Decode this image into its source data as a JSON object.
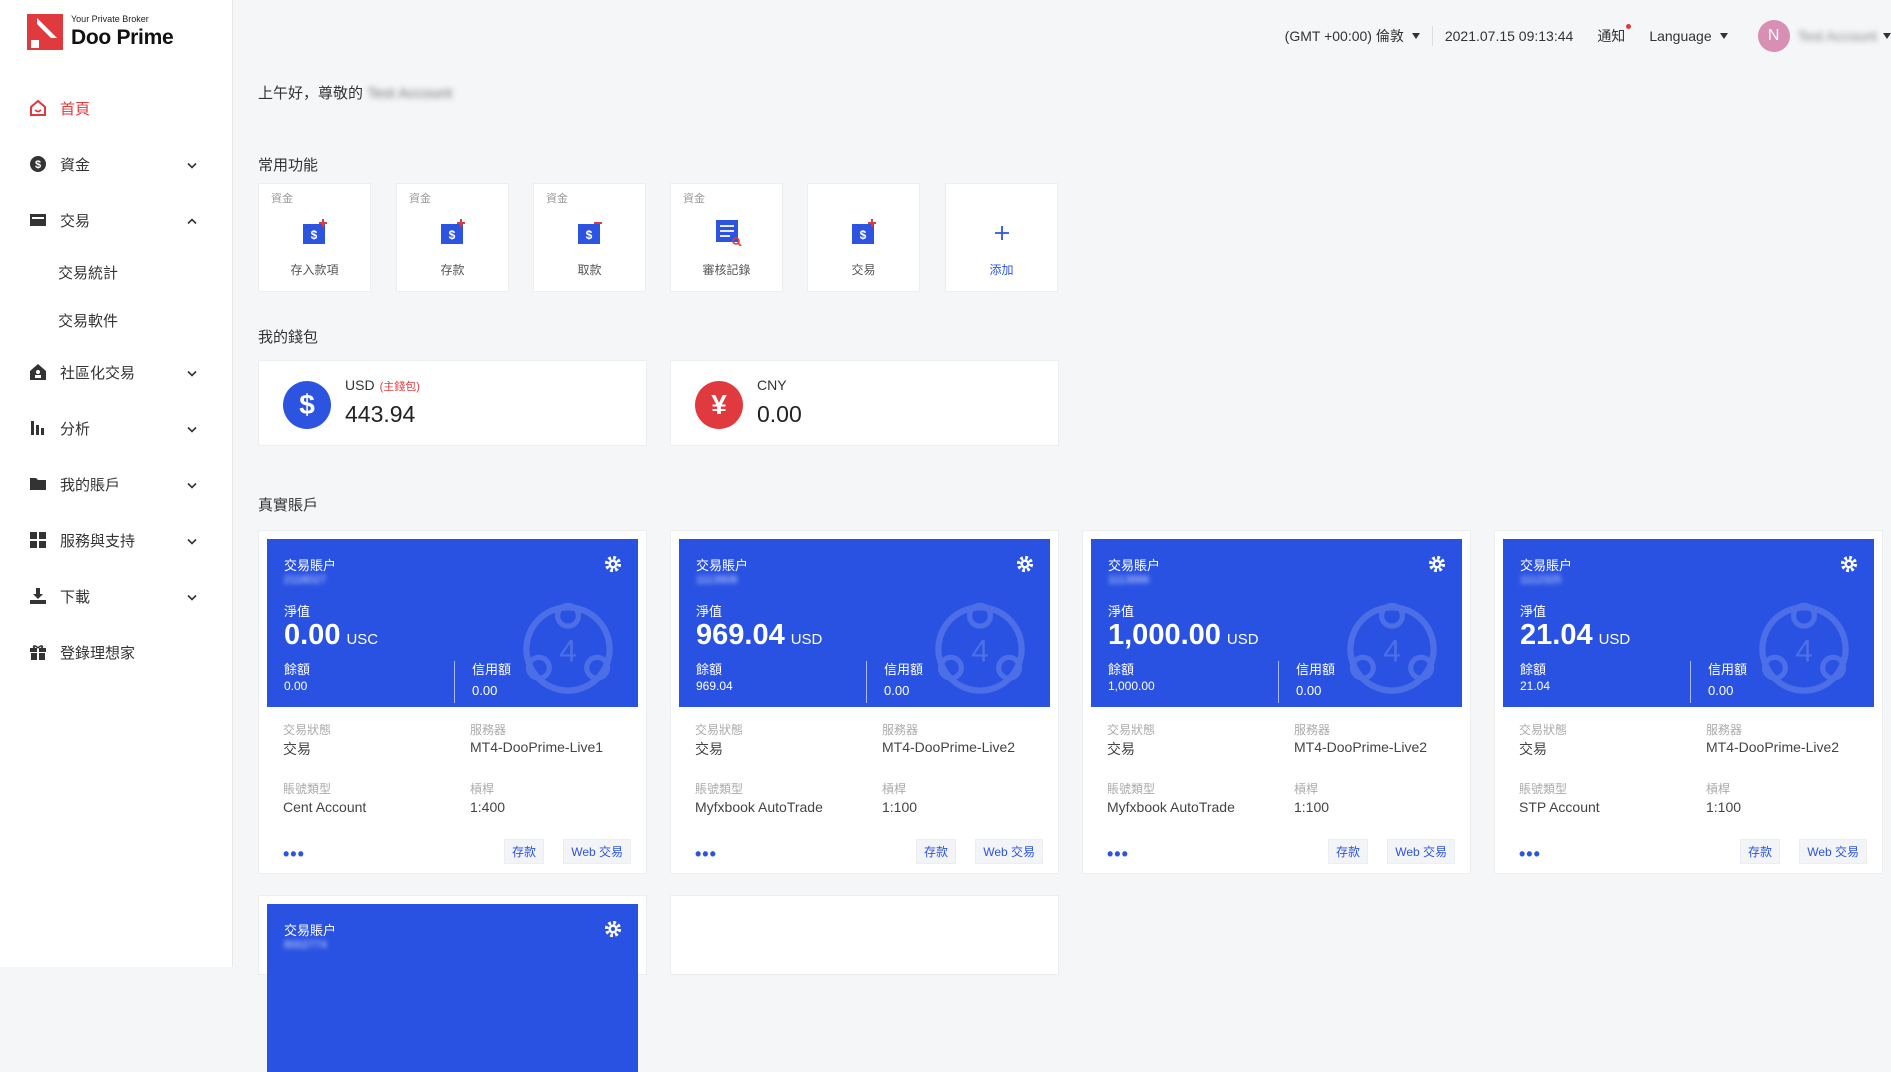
{
  "brand": {
    "tagline": "Your Private Broker",
    "name": "Doo Prime"
  },
  "colors": {
    "accent_red": "#e03a3e",
    "primary_blue": "#2952e3"
  },
  "nav": {
    "home": "首頁",
    "funds": "資金",
    "trade": "交易",
    "trade_stats": "交易統計",
    "trade_software": "交易軟件",
    "social": "社區化交易",
    "analysis": "分析",
    "my_accounts": "我的賬戶",
    "service": "服務與支持",
    "download": "下載",
    "ideas": "登錄理想家"
  },
  "header": {
    "timezone": "(GMT +00:00) 倫敦",
    "datetime": "2021.07.15 09:13:44",
    "notifications": "通知",
    "language": "Language",
    "avatar_initial": "N",
    "username": "Test Account"
  },
  "greeting": {
    "text": "上午好，尊敬的",
    "name": "Test Account"
  },
  "sections": {
    "quick": "常用功能",
    "wallet": "我的錢包",
    "real": "真實賬戶"
  },
  "quick": [
    {
      "cat": "資金",
      "label": "存入款項",
      "icon": "deposit-icon"
    },
    {
      "cat": "資金",
      "label": "存款",
      "icon": "deposit-icon"
    },
    {
      "cat": "資金",
      "label": "取款",
      "icon": "withdraw-icon"
    },
    {
      "cat": "資金",
      "label": "審核記錄",
      "icon": "review-icon"
    },
    {
      "cat": "",
      "label": "交易",
      "icon": "trade-icon"
    },
    {
      "cat": "",
      "label": "添加",
      "icon": "plus-icon"
    }
  ],
  "wallets": [
    {
      "currency": "USD",
      "main": "(主錢包)",
      "amount": "443.94",
      "symbol": "$"
    },
    {
      "currency": "CNY",
      "main": "",
      "amount": "0.00",
      "symbol": "¥"
    }
  ],
  "account_labels": {
    "title": "交易賬户",
    "equity": "淨值",
    "balance": "餘額",
    "credit": "信用額",
    "status": "交易狀態",
    "server": "服務器",
    "type": "賬號類型",
    "leverage": "槓桿",
    "more": "•••",
    "deposit": "存款",
    "web_trade": "Web 交易"
  },
  "accounts": [
    {
      "number": "2118027",
      "equity": "0.00",
      "unit": "USC",
      "balance": "0.00",
      "credit": "0.00",
      "status": "交易",
      "server": "MT4-DooPrime-Live1",
      "type": "Cent Account",
      "leverage": "1:400"
    },
    {
      "number": "1113908",
      "equity": "969.04",
      "unit": "USD",
      "balance": "969.04",
      "credit": "0.00",
      "status": "交易",
      "server": "MT4-DooPrime-Live2",
      "type": "Myfxbook AutoTrade",
      "leverage": "1:100"
    },
    {
      "number": "1113886",
      "equity": "1,000.00",
      "unit": "USD",
      "balance": "1,000.00",
      "credit": "0.00",
      "status": "交易",
      "server": "MT4-DooPrime-Live2",
      "type": "Myfxbook AutoTrade",
      "leverage": "1:100"
    },
    {
      "number": "1112325",
      "equity": "21.04",
      "unit": "USD",
      "balance": "21.04",
      "credit": "0.00",
      "status": "交易",
      "server": "MT4-DooPrime-Live2",
      "type": "STP Account",
      "leverage": "1:100"
    },
    {
      "number": "8002774"
    }
  ]
}
